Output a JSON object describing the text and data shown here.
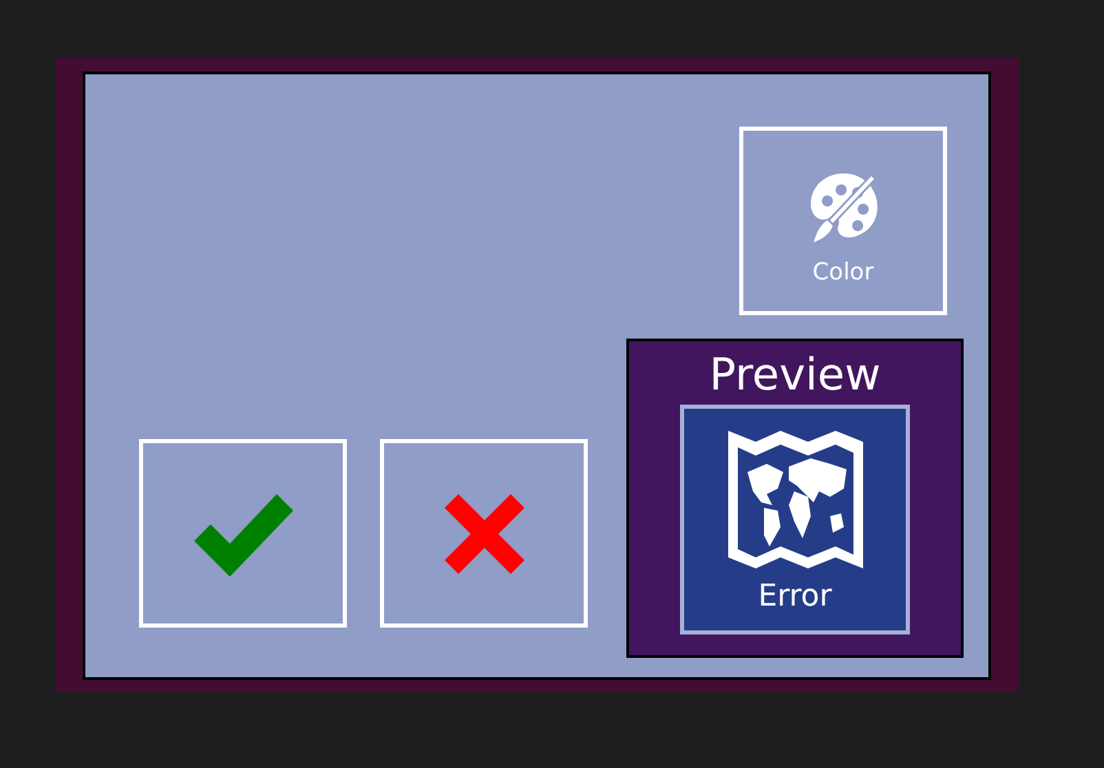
{
  "color_button": {
    "label": "Color"
  },
  "preview": {
    "title": "Preview",
    "tile": {
      "label": "Error"
    }
  }
}
